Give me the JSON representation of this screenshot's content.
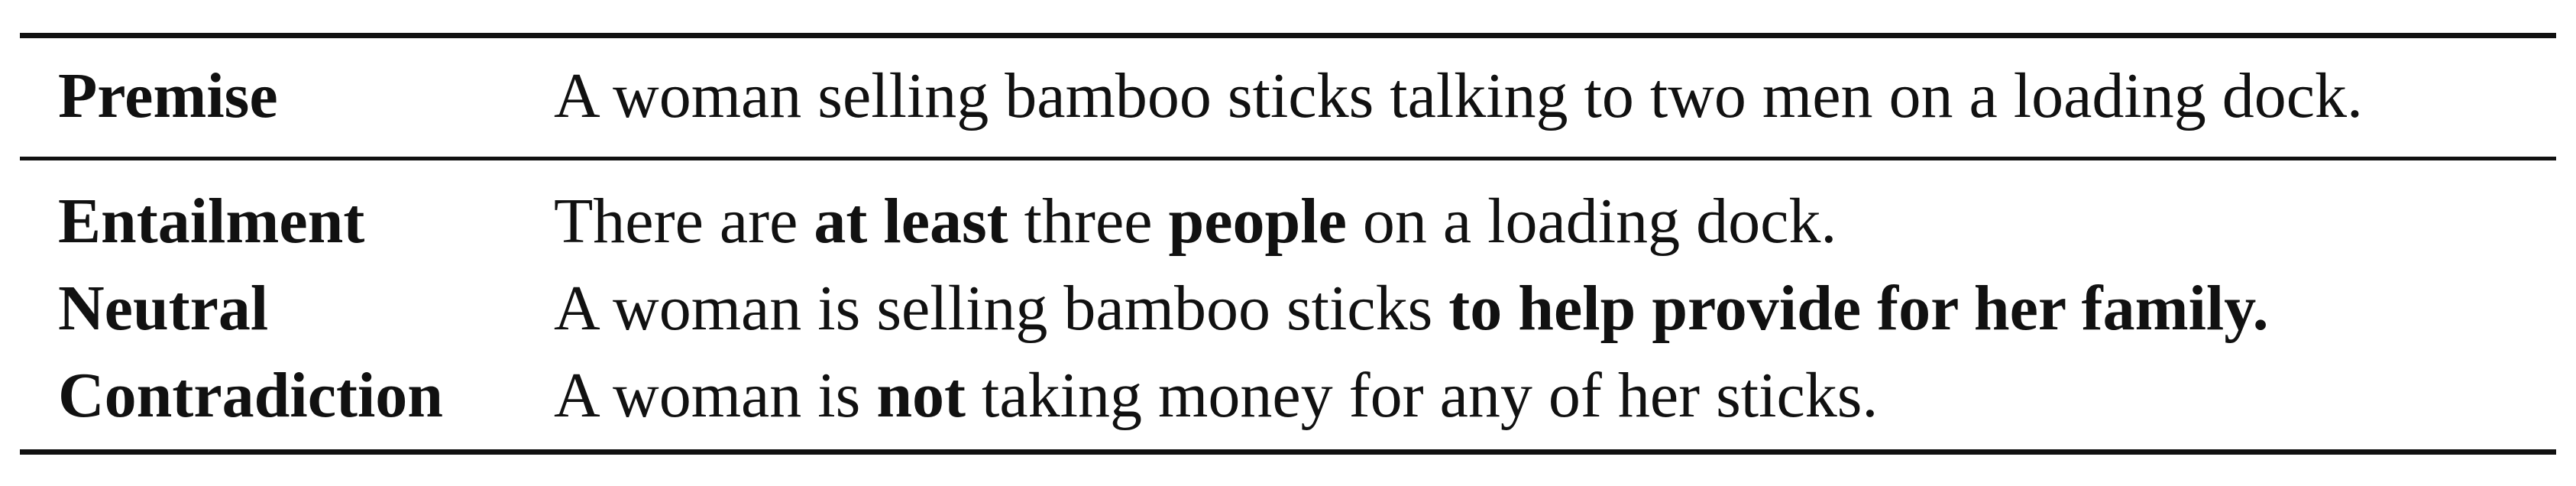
{
  "table": {
    "premise": {
      "label": "Premise",
      "segments": [
        "A woman selling bamboo sticks talking to two men on a loading dock."
      ]
    },
    "rows": [
      {
        "label": "Entailment",
        "segments": [
          "There are ",
          "at least",
          " three ",
          "people",
          " on a loading dock."
        ]
      },
      {
        "label": "Neutral",
        "segments": [
          "A woman is selling bamboo sticks ",
          "to help provide for her family."
        ]
      },
      {
        "label": "Contradiction",
        "segments": [
          "A woman is ",
          "not",
          " taking money for any of her sticks."
        ]
      }
    ]
  }
}
